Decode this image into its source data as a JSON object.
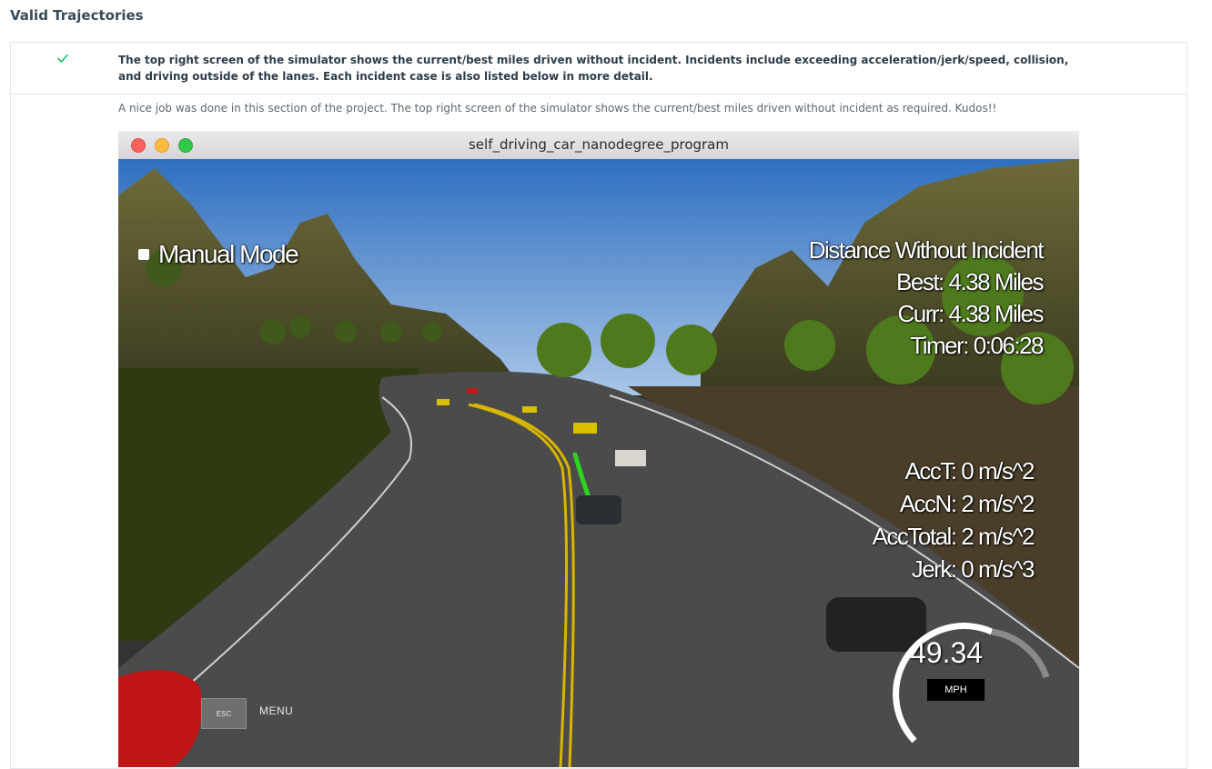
{
  "section": {
    "title": "Valid Trajectories"
  },
  "rubric": {
    "status_icon": "checkmark-icon",
    "status_color": "#02b3e4",
    "criterion": "The top right screen of the simulator shows the current/best miles driven without incident. Incidents include exceeding acceleration/jerk/speed, collision, and driving outside of the lanes. Each incident case is also listed below in more detail.",
    "reviewer_comment": "A nice job was done in this section of the project. The top right screen of the simulator shows the current/best miles driven without incident as required. Kudos!!"
  },
  "simulator": {
    "window_title": "self_driving_car_nanodegree_program",
    "manual_mode_label": "Manual Mode",
    "distance": {
      "heading": "Distance Without Incident",
      "best": "Best: 4.38 Miles",
      "curr": "Curr: 4.38 Miles",
      "timer": "Timer: 0:06:28"
    },
    "acceleration": {
      "acc_t": "AccT: 0 m/s^2",
      "acc_n": "AccN: 2 m/s^2",
      "acc_total": "AccTotal: 2 m/s^2",
      "jerk": "Jerk: 0 m/s^3"
    },
    "speedometer": {
      "value": "49.34",
      "unit": "MPH",
      "fill_fraction": 0.55
    },
    "esc_label": "ESC",
    "menu_label": "MENU"
  }
}
